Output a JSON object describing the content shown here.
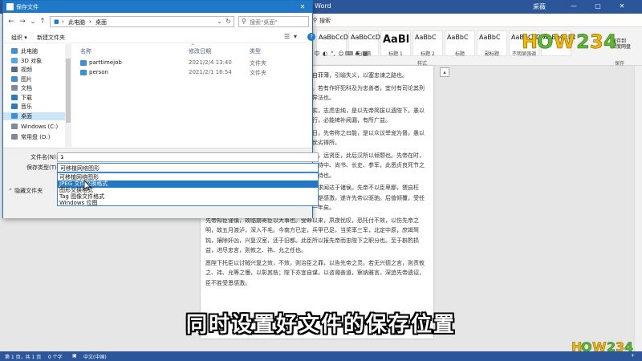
{
  "word": {
    "title": "Word",
    "user": "采薇",
    "tab_search": "搜索",
    "styles": [
      {
        "sample": "AaBbCcDc",
        "name": "",
        "big": false
      },
      {
        "sample": "AaBbCcDc",
        "name": "无间隔",
        "big": false
      },
      {
        "sample": "AaBl",
        "name": "标题 1",
        "big": true
      },
      {
        "sample": "AaBbC",
        "name": "标题 2",
        "big": false
      },
      {
        "sample": "AaBbC",
        "name": "标题",
        "big": false
      },
      {
        "sample": "AaBbC",
        "name": "副标题",
        "big": false
      },
      {
        "sample": "AaBbCcDt",
        "name": "不明显强调",
        "big": false
      },
      {
        "sample": "AaBbCcDt",
        "name": "",
        "big": false
      }
    ],
    "style_section": "样式",
    "save_section": "保存",
    "save_to_baidu": "保存到\n百度网盘",
    "doc_paragraphs": [
      "尔，以光先帝遗德，恢弘志士之气，不宜妄自菲薄，引喻失义，以塞忠谏之路也。",
      "宫中府中，俱为一体，陟罚臧否，不宜异同。若有作奸犯科及为忠善者，宜付有司论其刑赏，以昭陛下平明之理，不宜偏私，使内外异法也。",
      "侍中、侍郎郭攸之、费祎、董允等，此皆良实，志虑忠纯，是以先帝简拔以遗陛下。愚以为宫中之事，事无大小，悉以咨之，然后施行，必能裨补阙漏，有所广益。",
      "将军向宠，性行淑均，晓畅军事，试用于昔日，先帝称之曰能，是以众议举宠为督。愚以为营中之事，悉以咨之，必能使行阵和睦，优劣得所。",
      "亲贤臣，远小人，此先汉所以兴隆也；亲小人，远贤臣，此后汉所以倾颓也。先帝在时，每与臣论此事，未尝不叹息痛恨于桓、灵也。侍中、尚书、长史、参军，此悉贞良死节之臣，愿陛下亲之信之，则汉室之隆，可计日而待也。",
      "臣本布衣，躬耕于南阳，苟全性命于乱世，不求闻达于诸侯。先帝不以臣卑鄙，猥自枉屈，三顾臣于草庐之中，咨臣以当世之事，由是感激，遂许先帝以驱驰。后值倾覆，受任于败军之际，奉命于危难之间，尔来二十有一年矣。",
      "先帝知臣谨慎，故临崩寄臣以大事也。受命以来，夙夜忧叹，恐托付不效，以伤先帝之明，故五月渡泸，深入不毛。今南方已定，兵甲已足，当奖率三军，北定中原，庶竭驽钝，攘除奸凶，兴复汉室，还于旧都。此臣所以报先帝而忠陛下之职分也。至于斟酌损益，进尽忠言，则攸之、祎、允之任也。",
      "愿陛下托臣以讨贼兴复之效，不效，则治臣之罪，以告先帝之灵。若无兴德之言，则责攸之、祎、允等之慢，以彰其咎；陛下亦宜自谋，以咨诹善道，察纳雅言，深追先帝遗诏，臣不胜受恩感激。"
    ],
    "status": {
      "page": "第 1 页，共 1 页",
      "words": "0 个字",
      "lang": "中文(中国)",
      "zoom": "+"
    }
  },
  "logo": "HOW234",
  "caption": "同时设置好文件的保存位置",
  "dialog": {
    "title": "保存文件",
    "address": [
      "此电脑",
      "桌面"
    ],
    "search_placeholder": "搜索\"桌面\"",
    "organize": "组织 ▾",
    "new_folder": "新建文件夹",
    "sidebar": [
      {
        "label": "此电脑",
        "color": "#3b8fd6",
        "selected": false
      },
      {
        "label": "3D 对象",
        "color": "#59a7e6",
        "selected": false
      },
      {
        "label": "视频",
        "color": "#5f6b7a",
        "selected": false
      },
      {
        "label": "图片",
        "color": "#3b8fd6",
        "selected": false
      },
      {
        "label": "文档",
        "color": "#7d8a99",
        "selected": false
      },
      {
        "label": "下载",
        "color": "#2a7ac4",
        "selected": false
      },
      {
        "label": "音乐",
        "color": "#2a7ac4",
        "selected": false
      },
      {
        "label": "桌面",
        "color": "#3b8fd6",
        "selected": true
      },
      {
        "label": "Windows (C:)",
        "color": "#7d8a99",
        "selected": false
      },
      {
        "label": "常用盘 (D:)",
        "color": "#7d8a99",
        "selected": false
      }
    ],
    "columns": [
      "名称",
      "修改日期",
      "类型"
    ],
    "files": [
      {
        "name": "parttimejob",
        "date": "2021/2/4 13:40",
        "type": "文件夹"
      },
      {
        "name": "person",
        "date": "2021/2/1 16:54",
        "type": "文件夹"
      }
    ],
    "filename_label": "文件名(N):",
    "filename_value": "1",
    "filetype_label": "保存类型(T):",
    "filetype_value": "可移植网络图形",
    "type_options": [
      "可移植网络图形",
      "JPEG 文件交换格式",
      "图形交换格式",
      "Tag 图像文件格式",
      "Windows 位图"
    ],
    "hide_folders": "隐藏文件夹"
  }
}
